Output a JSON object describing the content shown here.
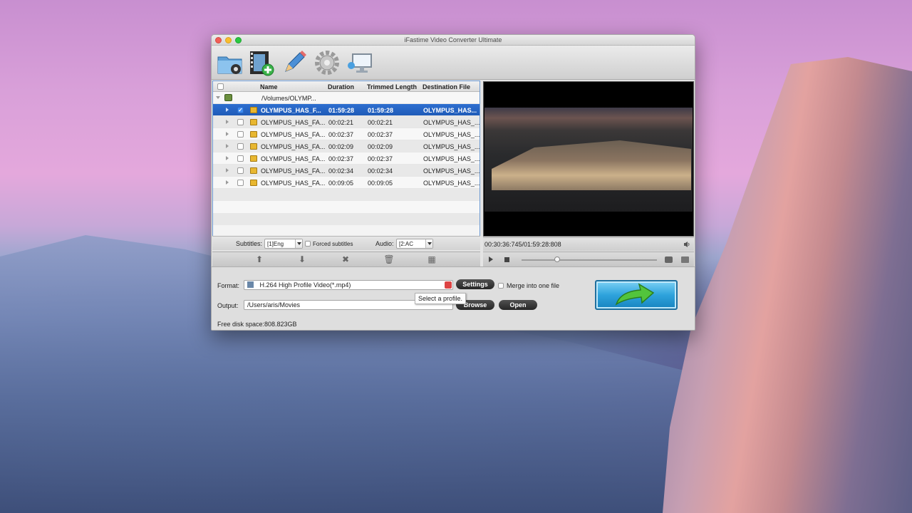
{
  "window": {
    "title": "iFastime Video Converter Ultimate"
  },
  "toolbar": {
    "buttons": [
      {
        "icon": "folder-icon"
      },
      {
        "icon": "add-video-icon"
      },
      {
        "icon": "edit-pencil-icon"
      },
      {
        "icon": "gear-icon"
      },
      {
        "icon": "monitor-icon"
      }
    ]
  },
  "list": {
    "headers": {
      "name": "Name",
      "duration": "Duration",
      "trimmed": "Trimmed Length",
      "destination": "Destination File"
    },
    "folder": "/Volumes/OLYMP...",
    "rows": [
      {
        "checked": true,
        "name": "OLYMPUS_HAS_F...",
        "duration": "01:59:28",
        "trimmed": "01:59:28",
        "destination": "OLYMPUS_HAS..."
      },
      {
        "checked": false,
        "name": "OLYMPUS_HAS_FA...",
        "duration": "00:02:21",
        "trimmed": "00:02:21",
        "destination": "OLYMPUS_HAS_..."
      },
      {
        "checked": false,
        "name": "OLYMPUS_HAS_FA...",
        "duration": "00:02:37",
        "trimmed": "00:02:37",
        "destination": "OLYMPUS_HAS_..."
      },
      {
        "checked": false,
        "name": "OLYMPUS_HAS_FA...",
        "duration": "00:02:09",
        "trimmed": "00:02:09",
        "destination": "OLYMPUS_HAS_..."
      },
      {
        "checked": false,
        "name": "OLYMPUS_HAS_FA...",
        "duration": "00:02:37",
        "trimmed": "00:02:37",
        "destination": "OLYMPUS_HAS_..."
      },
      {
        "checked": false,
        "name": "OLYMPUS_HAS_FA...",
        "duration": "00:02:34",
        "trimmed": "00:02:34",
        "destination": "OLYMPUS_HAS_..."
      },
      {
        "checked": false,
        "name": "OLYMPUS_HAS_FA...",
        "duration": "00:09:05",
        "trimmed": "00:09:05",
        "destination": "OLYMPUS_HAS_..."
      }
    ],
    "subtitles_label": "Subtitles:",
    "subtitles_value": "[1]Eng",
    "forced_subtitles_label": "Forced subtitles",
    "audio_label": "Audio:",
    "audio_value": "[2:AC"
  },
  "actions": {
    "icons": [
      "move-up-icon",
      "move-down-icon",
      "remove-icon",
      "trash-icon",
      "merge-icon"
    ]
  },
  "preview": {
    "timecode": "00:30:36:745/01:59:28:808"
  },
  "bottom": {
    "format_label": "Format:",
    "format_value": "H.264 High Profile Video(*.mp4)",
    "settings_label": "Settings",
    "merge_label": "Merge into one file",
    "tooltip": "Select a profile.",
    "output_label": "Output:",
    "output_value": "/Users/aris/Movies",
    "browse_label": "Browse",
    "open_label": "Open",
    "disk_space": "Free disk space:808.823GB"
  }
}
